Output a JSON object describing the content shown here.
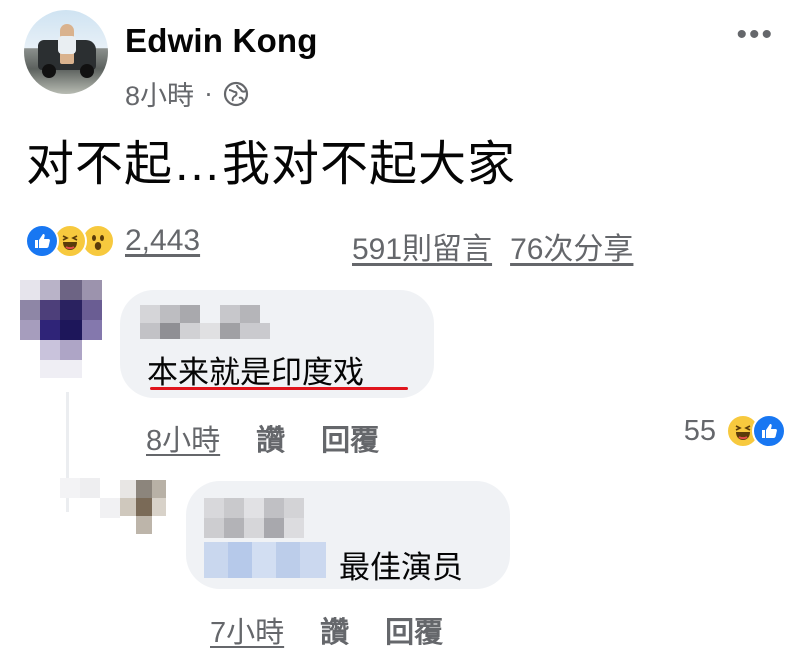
{
  "post": {
    "author": "Edwin Kong",
    "time": "8小時",
    "separator": "·",
    "privacy_icon": "globe-icon",
    "more_icon": "ellipsis-icon",
    "more_label": "•••",
    "text": "对不起…我对不起大家"
  },
  "engagement": {
    "reaction_icons": [
      "like-icon",
      "haha-icon",
      "wow-icon"
    ],
    "reaction_count": "2,443",
    "comments": "591則留言",
    "shares": "76次分享"
  },
  "comments": [
    {
      "text": "本来就是印度戏",
      "time": "8小時",
      "like_label": "讚",
      "reply_label": "回覆",
      "reaction_count": "55",
      "reaction_icons": [
        "haha-icon",
        "like-icon"
      ],
      "highlight_color": "#e0151d"
    },
    {
      "text": "最佳演员",
      "time": "7小時",
      "like_label": "讚",
      "reply_label": "回覆"
    }
  ],
  "colors": {
    "brand_blue": "#1877f2",
    "secondary_text": "#65676b",
    "bubble_bg": "#f0f2f5"
  }
}
